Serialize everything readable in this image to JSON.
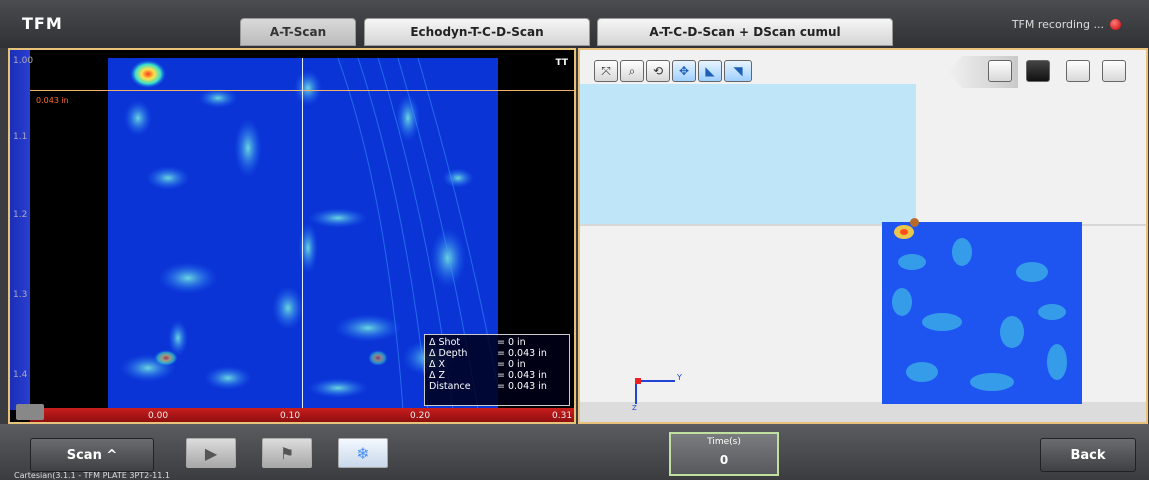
{
  "app": {
    "title": "TFM"
  },
  "tabs": [
    {
      "label": "A-T-Scan"
    },
    {
      "label": "Echodyn-T-C-D-Scan"
    },
    {
      "label": "A-T-C-D-Scan + DScan cumul"
    }
  ],
  "status": {
    "recording": "TFM recording ..."
  },
  "left_view": {
    "gate_label": "0.043 in",
    "corner_tag": "TT",
    "h_ruler": [
      "0.00",
      "0.10",
      "0.20",
      "0.31"
    ],
    "v_ruler": [
      "1.00",
      "1.1",
      "1.2",
      "1.3",
      "1.4"
    ],
    "measure": [
      {
        "key": "Δ Shot",
        "value": "= 0 in"
      },
      {
        "key": "Δ Depth",
        "value": "= 0.043 in"
      },
      {
        "key": "Δ X",
        "value": "= 0 in"
      },
      {
        "key": "Δ Z",
        "value": "= 0.043 in"
      },
      {
        "key": "Distance",
        "value": "= 0.043 in"
      }
    ]
  },
  "right_view": {
    "axis_y": "Y",
    "axis_z": "Z"
  },
  "toolbar": {
    "icons": [
      "fit-icon",
      "zoom-icon",
      "rotate-icon",
      "pan-icon",
      "view-side-icon",
      "view-top-icon"
    ]
  },
  "bottom": {
    "scan_label": "Scan ^",
    "time_label": "Time(s)",
    "time_value": "0",
    "back_label": "Back",
    "footer": "Cartesian(3.1.1 - TFM PLATE 3PT2-11.1"
  },
  "colors": {
    "accent_border": "#e8c27a",
    "scan_blue": "#0a3ad8",
    "rec": "#c60000"
  }
}
